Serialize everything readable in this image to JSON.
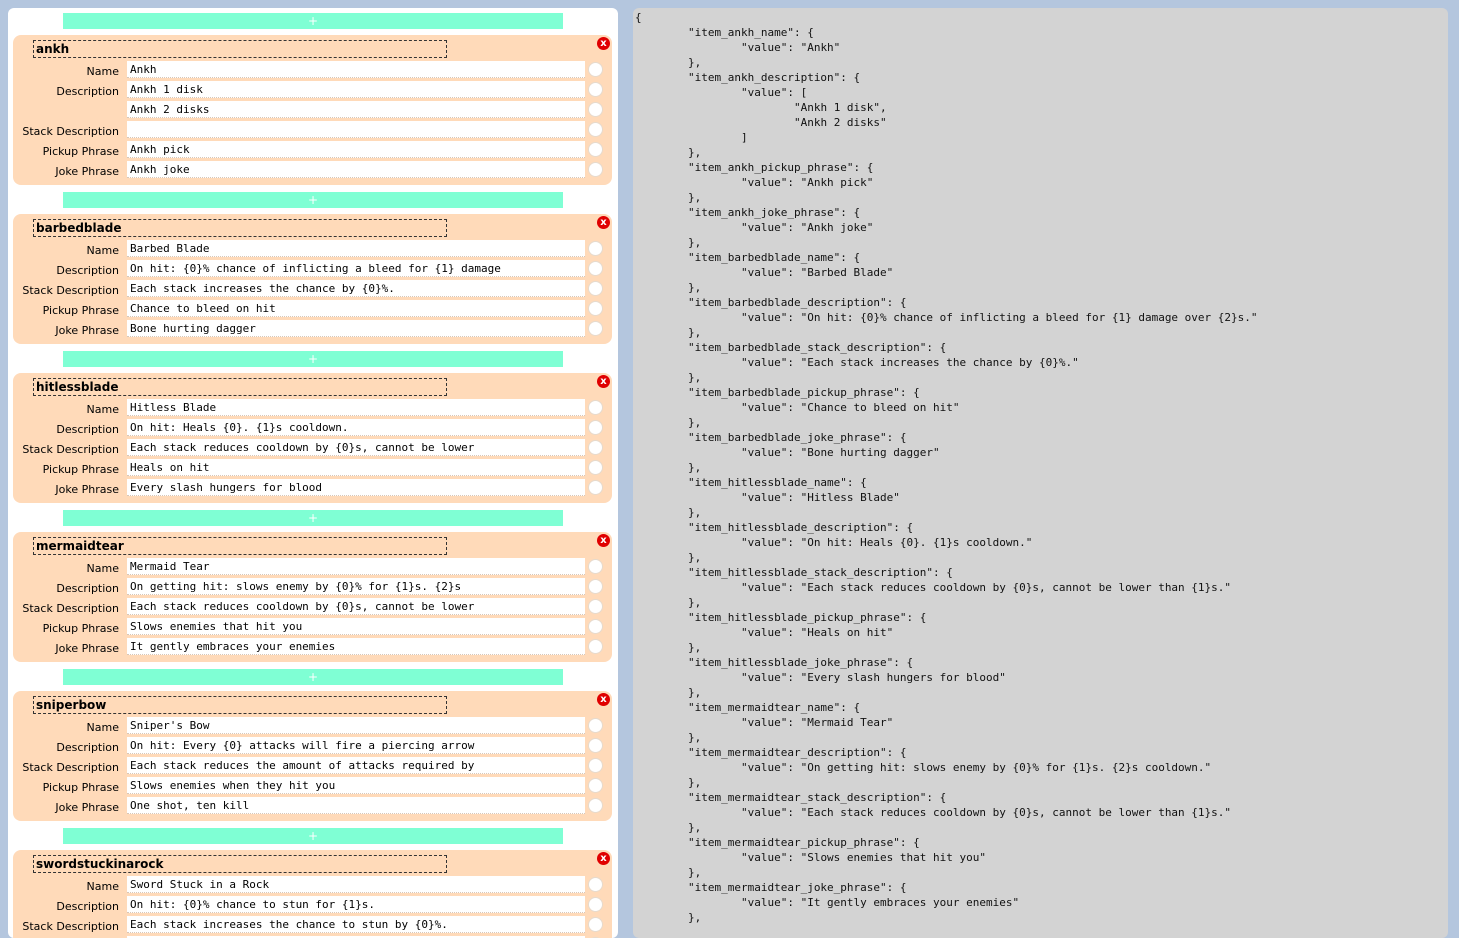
{
  "labels": {
    "add": "+",
    "close": "x",
    "name": "Name",
    "description": "Description",
    "stack_description": "Stack Description",
    "pickup_phrase": "Pickup Phrase",
    "joke_phrase": "Joke Phrase"
  },
  "items": [
    {
      "key": "ankh",
      "name": "Ankh",
      "description": [
        "Ankh 1 disk",
        "Ankh 2 disks"
      ],
      "stack_description": "",
      "pickup_phrase": "Ankh pick",
      "joke_phrase": "Ankh joke"
    },
    {
      "key": "barbedblade",
      "name": "Barbed Blade",
      "description": [
        "On hit: {0}% chance of inflicting a bleed for {1} damage"
      ],
      "stack_description": "Each stack increases the chance by {0}%.",
      "pickup_phrase": "Chance to bleed on hit",
      "joke_phrase": "Bone hurting dagger"
    },
    {
      "key": "hitlessblade",
      "name": "Hitless Blade",
      "description": [
        "On hit: Heals {0}. {1}s cooldown."
      ],
      "stack_description": "Each stack reduces cooldown by {0}s, cannot be lower",
      "pickup_phrase": "Heals on hit",
      "joke_phrase": "Every slash hungers for blood"
    },
    {
      "key": "mermaidtear",
      "name": "Mermaid Tear",
      "description": [
        "On getting hit: slows enemy by {0}% for {1}s. {2}s"
      ],
      "stack_description": "Each stack reduces cooldown by {0}s, cannot be lower",
      "pickup_phrase": "Slows enemies that hit you",
      "joke_phrase": "It gently embraces your enemies"
    },
    {
      "key": "sniperbow",
      "name": "Sniper's Bow",
      "description": [
        "On hit: Every {0} attacks will fire a piercing arrow"
      ],
      "stack_description": "Each stack reduces the amount of attacks required by",
      "pickup_phrase": "Slows enemies when they hit you",
      "joke_phrase": "One shot, ten kill"
    },
    {
      "key": "swordstuckinarock",
      "name": "Sword Stuck in a Rock",
      "description": [
        "On hit: {0}% chance to stun for {1}s."
      ],
      "stack_description": "Each stack increases the chance to stun by {0}%.",
      "pickup_phrase": "",
      "joke_phrase": ""
    }
  ],
  "json_preview": "{\n\t\"item_ankh_name\": {\n\t\t\"value\": \"Ankh\"\n\t},\n\t\"item_ankh_description\": {\n\t\t\"value\": [\n\t\t\t\"Ankh 1 disk\",\n\t\t\t\"Ankh 2 disks\"\n\t\t]\n\t},\n\t\"item_ankh_pickup_phrase\": {\n\t\t\"value\": \"Ankh pick\"\n\t},\n\t\"item_ankh_joke_phrase\": {\n\t\t\"value\": \"Ankh joke\"\n\t},\n\t\"item_barbedblade_name\": {\n\t\t\"value\": \"Barbed Blade\"\n\t},\n\t\"item_barbedblade_description\": {\n\t\t\"value\": \"On hit: {0}% chance of inflicting a bleed for {1} damage over {2}s.\"\n\t},\n\t\"item_barbedblade_stack_description\": {\n\t\t\"value\": \"Each stack increases the chance by {0}%.\"\n\t},\n\t\"item_barbedblade_pickup_phrase\": {\n\t\t\"value\": \"Chance to bleed on hit\"\n\t},\n\t\"item_barbedblade_joke_phrase\": {\n\t\t\"value\": \"Bone hurting dagger\"\n\t},\n\t\"item_hitlessblade_name\": {\n\t\t\"value\": \"Hitless Blade\"\n\t},\n\t\"item_hitlessblade_description\": {\n\t\t\"value\": \"On hit: Heals {0}. {1}s cooldown.\"\n\t},\n\t\"item_hitlessblade_stack_description\": {\n\t\t\"value\": \"Each stack reduces cooldown by {0}s, cannot be lower than {1}s.\"\n\t},\n\t\"item_hitlessblade_pickup_phrase\": {\n\t\t\"value\": \"Heals on hit\"\n\t},\n\t\"item_hitlessblade_joke_phrase\": {\n\t\t\"value\": \"Every slash hungers for blood\"\n\t},\n\t\"item_mermaidtear_name\": {\n\t\t\"value\": \"Mermaid Tear\"\n\t},\n\t\"item_mermaidtear_description\": {\n\t\t\"value\": \"On getting hit: slows enemy by {0}% for {1}s. {2}s cooldown.\"\n\t},\n\t\"item_mermaidtear_stack_description\": {\n\t\t\"value\": \"Each stack reduces cooldown by {0}s, cannot be lower than {1}s.\"\n\t},\n\t\"item_mermaidtear_pickup_phrase\": {\n\t\t\"value\": \"Slows enemies that hit you\"\n\t},\n\t\"item_mermaidtear_joke_phrase\": {\n\t\t\"value\": \"It gently embraces your enemies\"\n\t},"
}
